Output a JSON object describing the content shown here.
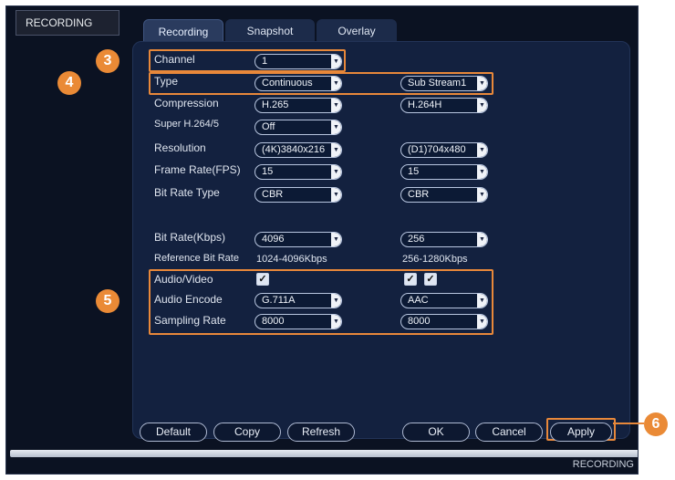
{
  "header": {
    "title": "RECORDING"
  },
  "tabs": [
    {
      "label": "Recording",
      "active": true
    },
    {
      "label": "Snapshot",
      "active": false
    },
    {
      "label": "Overlay",
      "active": false
    }
  ],
  "fields": {
    "channel": {
      "label": "Channel",
      "value": "1"
    },
    "type": {
      "label": "Type",
      "main": "Continuous",
      "sub": "Sub Stream1"
    },
    "compression": {
      "label": "Compression",
      "main": "H.265",
      "sub": "H.264H"
    },
    "super": {
      "label": "Super H.264/5",
      "main": "Off"
    },
    "resolution": {
      "label": "Resolution",
      "main": "(4K)3840x216",
      "sub": "(D1)704x480"
    },
    "framerate": {
      "label": "Frame Rate(FPS)",
      "main": "15",
      "sub": "15"
    },
    "bitratetype": {
      "label": "Bit Rate Type",
      "main": "CBR",
      "sub": "CBR"
    },
    "bitrate": {
      "label": "Bit Rate(Kbps)",
      "main": "4096",
      "sub": "256"
    },
    "refbitrate": {
      "label": "Reference Bit Rate",
      "main": "1024-4096Kbps",
      "sub": "256-1280Kbps"
    },
    "audiovideo": {
      "label": "Audio/Video"
    },
    "audioencode": {
      "label": "Audio Encode",
      "main": "G.711A",
      "sub": "AAC"
    },
    "sampling": {
      "label": "Sampling Rate",
      "main": "8000",
      "sub": "8000"
    }
  },
  "callouts": {
    "c3": "3",
    "c4": "4",
    "c5": "5",
    "c6": "6"
  },
  "buttons": {
    "default": "Default",
    "copy": "Copy",
    "refresh": "Refresh",
    "ok": "OK",
    "cancel": "Cancel",
    "apply": "Apply"
  },
  "icons": {
    "dropdown": "▼",
    "check": "✓"
  },
  "status": "RECORDING",
  "colors": {
    "accent": "#ea8a36",
    "panel": "#13213f",
    "background": "#0b1222"
  }
}
